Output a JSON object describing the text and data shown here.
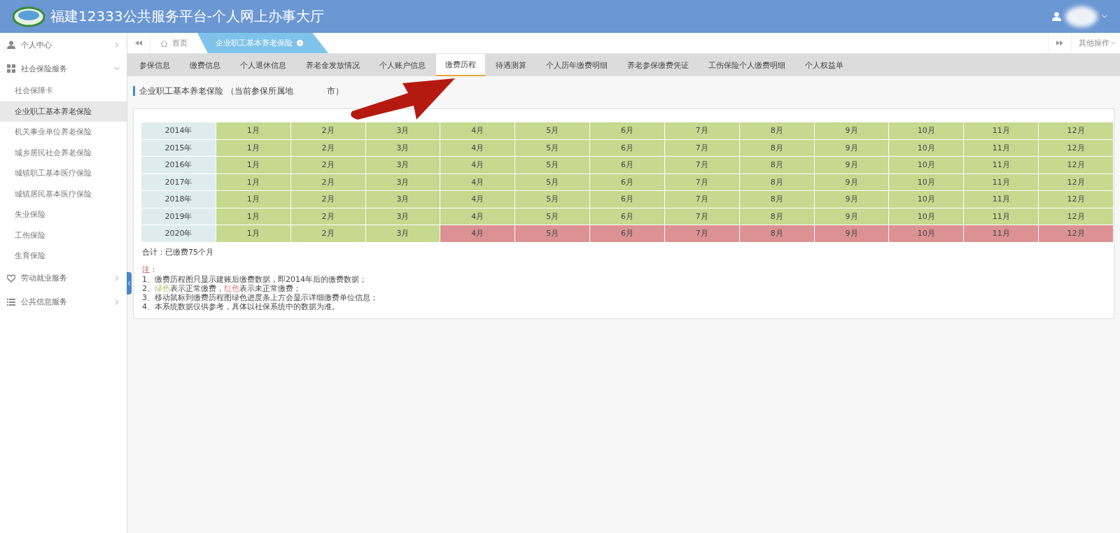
{
  "header": {
    "title": "福建12333公共服务平台-个人网上办事大厅"
  },
  "sidebar": {
    "groups": [
      {
        "label": "个人中心",
        "expanded": false
      },
      {
        "label": "社会保险服务",
        "expanded": true,
        "children": [
          {
            "label": "社会保障卡",
            "selected": false
          },
          {
            "label": "企业职工基本养老保险",
            "selected": true
          },
          {
            "label": "机关事业单位养老保险",
            "selected": false
          },
          {
            "label": "城乡居民社会养老保险",
            "selected": false
          },
          {
            "label": "城镇职工基本医疗保险",
            "selected": false
          },
          {
            "label": "城镇居民基本医疗保险",
            "selected": false
          },
          {
            "label": "失业保险",
            "selected": false
          },
          {
            "label": "工伤保险",
            "selected": false
          },
          {
            "label": "生育保险",
            "selected": false
          }
        ]
      },
      {
        "label": "劳动就业服务",
        "expanded": false
      },
      {
        "label": "公共信息服务",
        "expanded": false
      }
    ]
  },
  "page_tabs": [
    {
      "label": "首页",
      "kind": "home",
      "selected": false
    },
    {
      "label": "企业职工基本养老保险",
      "kind": "closable",
      "selected": true
    }
  ],
  "other_actions": "其他操作",
  "sub_tabs": [
    {
      "label": "参保信息",
      "selected": false
    },
    {
      "label": "缴费信息",
      "selected": false
    },
    {
      "label": "个人退休信息",
      "selected": false
    },
    {
      "label": "养老金发放情况",
      "selected": false
    },
    {
      "label": "个人账户信息",
      "selected": false
    },
    {
      "label": "缴费历程",
      "selected": true
    },
    {
      "label": "待遇测算",
      "selected": false
    },
    {
      "label": "个人历年缴费明细",
      "selected": false
    },
    {
      "label": "养老参保缴费凭证",
      "selected": false
    },
    {
      "label": "工伤保险个人缴费明细",
      "selected": false
    },
    {
      "label": "个人权益单",
      "selected": false
    }
  ],
  "section": {
    "title": "企业职工基本养老保险 （当前参保所属地",
    "title_end": "市）"
  },
  "table": {
    "rows": [
      {
        "year": "2014年",
        "months": [
          {
            "label": "1月",
            "paid": true
          },
          {
            "label": "2月",
            "paid": true
          },
          {
            "label": "3月",
            "paid": true
          },
          {
            "label": "4月",
            "paid": true
          },
          {
            "label": "5月",
            "paid": true
          },
          {
            "label": "6月",
            "paid": true
          },
          {
            "label": "7月",
            "paid": true
          },
          {
            "label": "8月",
            "paid": true
          },
          {
            "label": "9月",
            "paid": true
          },
          {
            "label": "10月",
            "paid": true
          },
          {
            "label": "11月",
            "paid": true
          },
          {
            "label": "12月",
            "paid": true
          }
        ]
      },
      {
        "year": "2015年",
        "months": [
          {
            "label": "1月",
            "paid": true
          },
          {
            "label": "2月",
            "paid": true
          },
          {
            "label": "3月",
            "paid": true
          },
          {
            "label": "4月",
            "paid": true
          },
          {
            "label": "5月",
            "paid": true
          },
          {
            "label": "6月",
            "paid": true
          },
          {
            "label": "7月",
            "paid": true
          },
          {
            "label": "8月",
            "paid": true
          },
          {
            "label": "9月",
            "paid": true
          },
          {
            "label": "10月",
            "paid": true
          },
          {
            "label": "11月",
            "paid": true
          },
          {
            "label": "12月",
            "paid": true
          }
        ]
      },
      {
        "year": "2016年",
        "months": [
          {
            "label": "1月",
            "paid": true
          },
          {
            "label": "2月",
            "paid": true
          },
          {
            "label": "3月",
            "paid": true
          },
          {
            "label": "4月",
            "paid": true
          },
          {
            "label": "5月",
            "paid": true
          },
          {
            "label": "6月",
            "paid": true
          },
          {
            "label": "7月",
            "paid": true
          },
          {
            "label": "8月",
            "paid": true
          },
          {
            "label": "9月",
            "paid": true
          },
          {
            "label": "10月",
            "paid": true
          },
          {
            "label": "11月",
            "paid": true
          },
          {
            "label": "12月",
            "paid": true
          }
        ]
      },
      {
        "year": "2017年",
        "months": [
          {
            "label": "1月",
            "paid": true
          },
          {
            "label": "2月",
            "paid": true
          },
          {
            "label": "3月",
            "paid": true
          },
          {
            "label": "4月",
            "paid": true
          },
          {
            "label": "5月",
            "paid": true
          },
          {
            "label": "6月",
            "paid": true
          },
          {
            "label": "7月",
            "paid": true
          },
          {
            "label": "8月",
            "paid": true
          },
          {
            "label": "9月",
            "paid": true
          },
          {
            "label": "10月",
            "paid": true
          },
          {
            "label": "11月",
            "paid": true
          },
          {
            "label": "12月",
            "paid": true
          }
        ]
      },
      {
        "year": "2018年",
        "months": [
          {
            "label": "1月",
            "paid": true
          },
          {
            "label": "2月",
            "paid": true
          },
          {
            "label": "3月",
            "paid": true
          },
          {
            "label": "4月",
            "paid": true
          },
          {
            "label": "5月",
            "paid": true
          },
          {
            "label": "6月",
            "paid": true
          },
          {
            "label": "7月",
            "paid": true
          },
          {
            "label": "8月",
            "paid": true
          },
          {
            "label": "9月",
            "paid": true
          },
          {
            "label": "10月",
            "paid": true
          },
          {
            "label": "11月",
            "paid": true
          },
          {
            "label": "12月",
            "paid": true
          }
        ]
      },
      {
        "year": "2019年",
        "months": [
          {
            "label": "1月",
            "paid": true
          },
          {
            "label": "2月",
            "paid": true
          },
          {
            "label": "3月",
            "paid": true
          },
          {
            "label": "4月",
            "paid": true
          },
          {
            "label": "5月",
            "paid": true
          },
          {
            "label": "6月",
            "paid": true
          },
          {
            "label": "7月",
            "paid": true
          },
          {
            "label": "8月",
            "paid": true
          },
          {
            "label": "9月",
            "paid": true
          },
          {
            "label": "10月",
            "paid": true
          },
          {
            "label": "11月",
            "paid": true
          },
          {
            "label": "12月",
            "paid": true
          }
        ]
      },
      {
        "year": "2020年",
        "months": [
          {
            "label": "1月",
            "paid": true
          },
          {
            "label": "2月",
            "paid": true
          },
          {
            "label": "3月",
            "paid": true
          },
          {
            "label": "4月",
            "paid": false
          },
          {
            "label": "5月",
            "paid": false
          },
          {
            "label": "6月",
            "paid": false
          },
          {
            "label": "7月",
            "paid": false
          },
          {
            "label": "8月",
            "paid": false
          },
          {
            "label": "9月",
            "paid": false
          },
          {
            "label": "10月",
            "paid": false
          },
          {
            "label": "11月",
            "paid": false
          },
          {
            "label": "12月",
            "paid": false
          }
        ]
      }
    ]
  },
  "summary": "合计：已缴费75个月",
  "notes": {
    "heading": "注：",
    "lines": [
      {
        "segments": [
          {
            "text": "1、缴费历程图只显示建账后缴费数据，即2014年后的缴费数据；",
            "kind": "normal"
          }
        ]
      },
      {
        "segments": [
          {
            "text": "2、",
            "kind": "normal"
          },
          {
            "text": "绿色",
            "kind": "paid"
          },
          {
            "text": "表示正常缴费，",
            "kind": "normal"
          },
          {
            "text": "红色",
            "kind": "unpaid"
          },
          {
            "text": "表示未正常缴费；",
            "kind": "normal"
          }
        ]
      },
      {
        "segments": [
          {
            "text": "3、移动鼠标到缴费历程图绿色进度条上方会显示详细缴费单位信息；",
            "kind": "normal"
          }
        ]
      },
      {
        "segments": [
          {
            "text": "4、本系统数据仅供参考，具体以社保系统中的数据为准。",
            "kind": "normal"
          }
        ]
      }
    ]
  }
}
